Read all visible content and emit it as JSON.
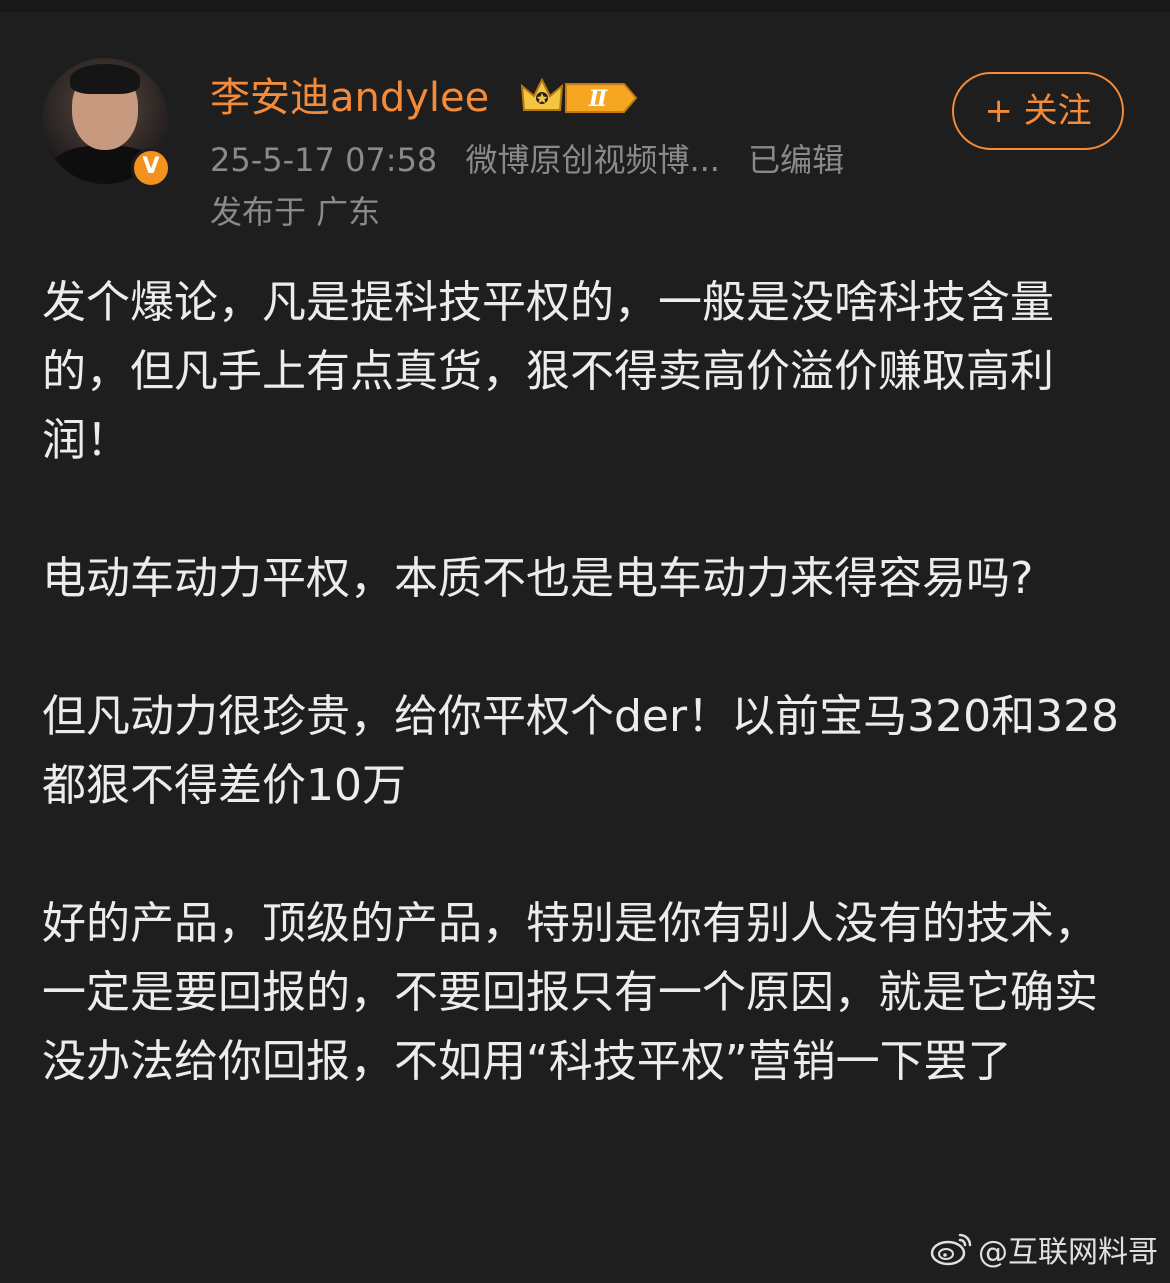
{
  "post": {
    "author": {
      "name": "李安迪andylee",
      "rank_badge": "Ⅱ",
      "verified_badge": "V",
      "avatar_icon": "user-avatar"
    },
    "timestamp": "25-5-17 07:58",
    "source": "微博原创视频博...",
    "edited_label": "已编辑",
    "location": "发布于 广东",
    "follow_button_label": "+ 关注",
    "paragraphs": [
      "发个爆论，凡是提科技平权的，一般是没啥科技含量的，但凡手上有点真货，狠不得卖高价溢价赚取高利润！",
      "电动车动力平权，本质不也是电车动力来得容易吗?",
      "但凡动力很珍贵，给你平权个der！以前宝马320和328都狠不得差价10万",
      "好的产品，顶级的产品，特别是你有别人没有的技术，一定是要回报的，不要回报只有一个原因，就是它确实没办法给你回报，不如用“科技平权”营销一下罢了"
    ]
  },
  "watermark": {
    "text": "@互联网料哥",
    "icon": "weibo-logo-icon"
  },
  "colors": {
    "background": "#1e1e1e",
    "accent": "#f38b3a",
    "meta_text": "#8a8a8a",
    "body_text": "#ececec"
  }
}
